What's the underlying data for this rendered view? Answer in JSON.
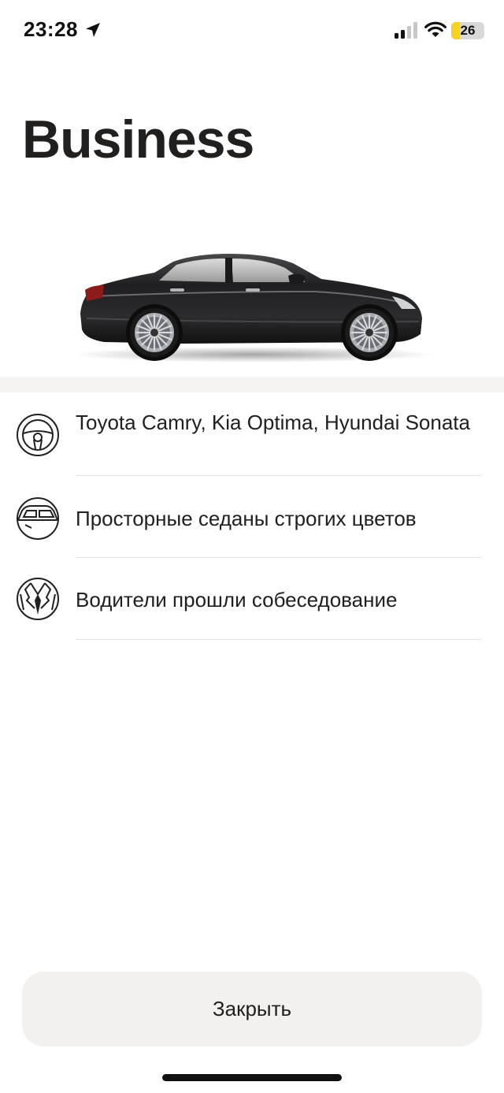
{
  "status_bar": {
    "time": "23:28",
    "battery": "26",
    "battery_color": "#f6d21b"
  },
  "title": "Business",
  "car_image": {
    "icon": "sedan-car-image",
    "color": "#1e1e20"
  },
  "features": [
    {
      "icon": "steering-wheel-icon",
      "text": "Toyota Camry, Kia Optima, Hyundai Sonata"
    },
    {
      "icon": "car-window-icon",
      "text": "Просторные седаны строгих цветов"
    },
    {
      "icon": "suit-tie-icon",
      "text": "Водители прошли собеседование"
    }
  ],
  "close_label": "Закрыть"
}
